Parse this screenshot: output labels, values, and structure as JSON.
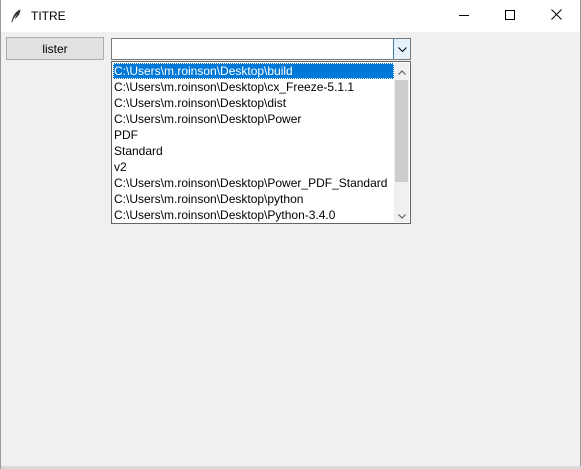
{
  "window": {
    "title": "TITRE",
    "icon": "feather-icon",
    "controls": {
      "minimize_icon": "minimize-icon",
      "maximize_icon": "maximize-icon",
      "close_icon": "close-icon"
    }
  },
  "toolbar": {
    "lister_label": "lister"
  },
  "combobox": {
    "value": "",
    "arrow_icon": "chevron-down-icon",
    "options": [
      "C:\\Users\\m.roinson\\Desktop\\build",
      "C:\\Users\\m.roinson\\Desktop\\cx_Freeze-5.1.1",
      "C:\\Users\\m.roinson\\Desktop\\dist",
      "C:\\Users\\m.roinson\\Desktop\\Power",
      "PDF",
      "Standard",
      "v2",
      "C:\\Users\\m.roinson\\Desktop\\Power_PDF_Standard",
      "C:\\Users\\m.roinson\\Desktop\\python",
      "C:\\Users\\m.roinson\\Desktop\\Python-3.4.0"
    ],
    "highlighted_index": 0,
    "scroll_up_icon": "scroll-up-icon",
    "scroll_down_icon": "scroll-down-icon"
  },
  "colors": {
    "selection": "#0078d7",
    "window_bg": "#f0f0f0",
    "titlebar_bg": "#ffffff"
  }
}
